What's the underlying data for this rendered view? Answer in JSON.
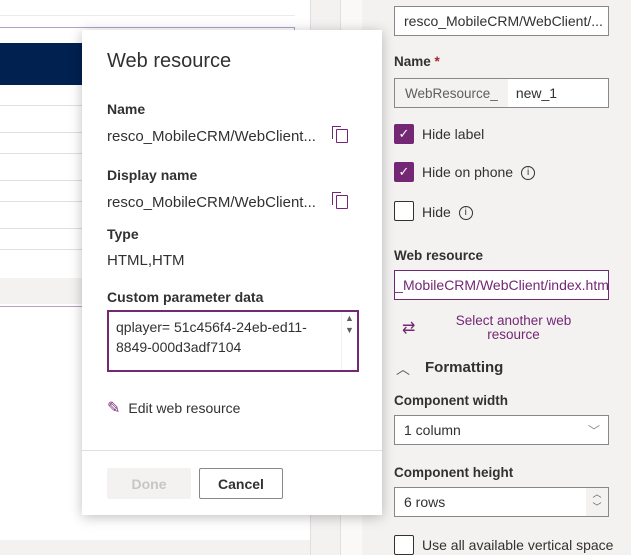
{
  "dialog": {
    "title": "Web resource",
    "name_label": "Name",
    "name_value": "resco_MobileCRM/WebClient...",
    "display_name_label": "Display name",
    "display_name_value": "resco_MobileCRM/WebClient...",
    "type_label": "Type",
    "type_value": "HTML,HTM",
    "custom_param_label": "Custom parameter data",
    "custom_param_value": "qplayer= 51c456f4-24eb-ed11-8849-000d3adf7104",
    "edit_label": "Edit web resource",
    "done_label": "Done",
    "cancel_label": "Cancel"
  },
  "properties": {
    "label_value": "resco_MobileCRM/WebClient/...",
    "name_label": "Name",
    "name_required": "*",
    "name_prefix": "WebResource_",
    "name_value": "new_1",
    "hide_label": "Hide label",
    "hide_on_phone": "Hide on phone",
    "hide": "Hide",
    "web_resource_label": "Web resource",
    "web_resource_value": "resco_MobileCRM/WebClient/index.html",
    "select_another": "Select another web resource",
    "formatting": "Formatting",
    "component_width_label": "Component width",
    "component_width_value": "1 column",
    "component_height_label": "Component height",
    "component_height_value": "6 rows",
    "use_all_space": "Use all available vertical space"
  },
  "colors": {
    "accent": "#742774",
    "navy": "#012150"
  }
}
